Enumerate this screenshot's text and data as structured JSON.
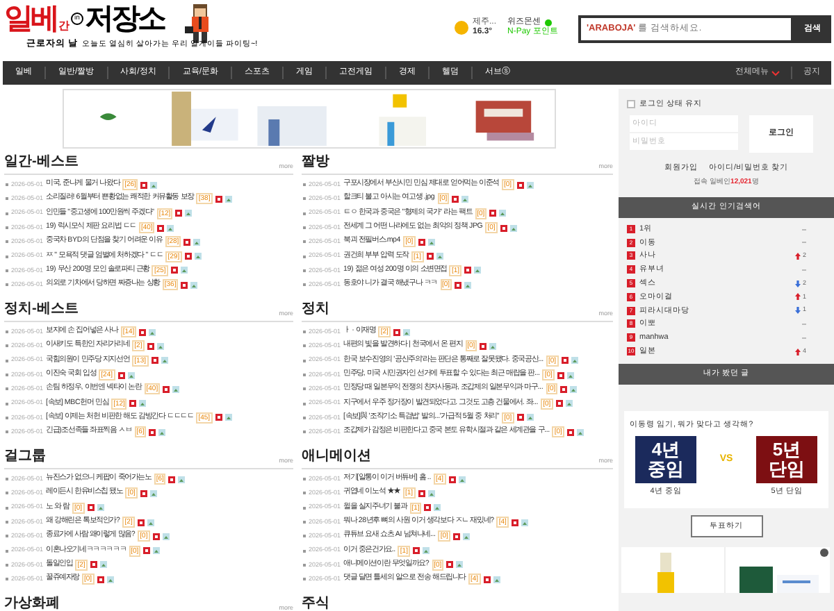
{
  "header": {
    "logo": {
      "main": "일베",
      "small": "간",
      "mark": "in",
      "right": "저장소"
    },
    "tagline_title": "근로자의 날",
    "tagline": "오늘도 열심히 살아가는 우리 일게이들 파이팅~!",
    "weather": {
      "place": "제주...",
      "temp": "16.3°"
    },
    "points": {
      "label": "위즈몬센",
      "value": "N-Pay 포인트"
    },
    "search": {
      "placeholder": "**'ARABOJA'** 를 검색하세요.",
      "button": "검색"
    }
  },
  "nav": {
    "items": [
      "일베",
      "일반/짤방",
      "사회/정치",
      "교육/문화",
      "스포츠",
      "게임",
      "고전게임",
      "경제",
      "헬덤",
      "서브ⓢ"
    ],
    "all_menu": "전체메뉴",
    "notice": "공지"
  },
  "sections": [
    {
      "title": "일간-베스트",
      "more": "more",
      "rows": [
        {
          "date": "2026-05-01",
          "title": "미국, 준나게 물거 나왔다",
          "count": "[26]"
        },
        {
          "date": "2026-05-01",
          "title": "소리질러! 6월부터 쁜황없는 쾌적한 커뮤활동 보장",
          "count": "[38]"
        },
        {
          "date": "2026-05-01",
          "title": "인민들 \"중고생에 100만원씩 주겠다\"",
          "count": "[12]"
        },
        {
          "date": "2026-05-01",
          "title": "19) 럭시모식 제판 요리법 ㄷㄷ",
          "count": "[40]"
        },
        {
          "date": "2026-05-01",
          "title": "중국차 BYD의 단점을 찾기 어려운 이유",
          "count": "[28]"
        },
        {
          "date": "2026-05-01",
          "title": "ㅉ \" 모욕적 댓글 엄벌에 처하겠다 \" ㄷㄷ",
          "count": "[29]"
        },
        {
          "date": "2026-05-01",
          "title": "19) 무산 200명 모인 솔로파티 근황",
          "count": "[25]"
        },
        {
          "date": "2026-05-01",
          "title": "의외로 기차에서 당하면 짜증나는 상황",
          "count": "[36]"
        }
      ]
    },
    {
      "title": "짤방",
      "more": "more",
      "rows": [
        {
          "date": "2026-05-01",
          "title": "구포시장에서 부산시민 민심 제대로 얻어먹는 이준석",
          "count": "[0]"
        },
        {
          "date": "2026-05-01",
          "title": "할크티 불고 아시는 여고생 .jpg",
          "count": "[0]"
        },
        {
          "date": "2026-05-01",
          "title": "ㅌㅇ 한국과 중국은 \"형제의 국가\" 라는 팩트",
          "count": "[0]"
        },
        {
          "date": "2026-05-01",
          "title": "전세계 그 어떤 나라에도 없는 최악의 정책 JPG",
          "count": "[0]"
        },
        {
          "date": "2026-05-01",
          "title": "북괴 전필버스.mp4",
          "count": "[0]"
        },
        {
          "date": "2026-05-01",
          "title": "권건희 부부 압력 도작",
          "count": "[1]"
        },
        {
          "date": "2026-05-01",
          "title": "19) 젊은 여성 200명 이의 소변면접",
          "count": "[1]"
        },
        {
          "date": "2026-05-01",
          "title": "동호야 니가 결국 해냈구나 ㅋㅋ",
          "count": "[0]"
        }
      ]
    },
    {
      "title": "정치-베스트",
      "more": "more",
      "rows": [
        {
          "date": "2026-05-01",
          "title": "보지에 손 집어넣은 사나",
          "count": "[14]"
        },
        {
          "date": "2026-05-01",
          "title": "이새키도 특한인 자리가리네",
          "count": "[2]"
        },
        {
          "date": "2026-05-01",
          "title": "국힘의원이 민주당 지지선언",
          "count": "[13]"
        },
        {
          "date": "2026-05-01",
          "title": "이진숙 국회 입성",
          "count": "[24]"
        },
        {
          "date": "2026-05-01",
          "title": "손팀 하정우, 이번엔 넥타이 논란",
          "count": "[40]"
        },
        {
          "date": "2026-05-01",
          "title": "[속보] MBC헌머 민심",
          "count": "[12]"
        },
        {
          "date": "2026-05-01",
          "title": "[속보] 이제는 처헌 비판한 해도 감방간다 ㄷㄷㄷㄷ",
          "count": "[45]"
        },
        {
          "date": "2026-05-01",
          "title": "긴급)조선족들 좌표찍음 ㅅㅂ",
          "count": "[6]"
        }
      ]
    },
    {
      "title": "정치",
      "more": "more",
      "rows": [
        {
          "date": "2026-05-01",
          "title": "ㅏ · 이재명",
          "count": "[2]"
        },
        {
          "date": "2026-05-01",
          "title": "내편의 빛을 발견하다 | 천국에서 온 편지",
          "count": "[0]"
        },
        {
          "date": "2026-05-01",
          "title": "한국 보수진영의 '공산주의'라는 판단은 통째로 잘못됐다. 중국공산...",
          "count": "[0]"
        },
        {
          "date": "2026-05-01",
          "title": "민주당, 미국 시민권자인 선거에 투표할 수 있다는 최근 매랍을 판...",
          "count": "[0]"
        },
        {
          "date": "2026-05-01",
          "title": "민정당 때 일본무익 전쟁의 친자사동과, 조갑제의 일본무익과 마구...",
          "count": "[0]"
        },
        {
          "date": "2026-05-01",
          "title": "지구에서 우주 정거장이 발견되었다고. 그것도 고층 건물에서. 좌...",
          "count": "[0]"
        },
        {
          "date": "2026-05-01",
          "title": "[속보]與 '조작기소 특검법' 발의...'가급적 5월 중 처리\"",
          "count": "[0]"
        },
        {
          "date": "2026-05-01",
          "title": "조갑제가 감정은 비판한다고 중국 본토 유학시절과 같은 세계관을 구...",
          "count": "[0]"
        }
      ]
    },
    {
      "title": "걸그룹",
      "more": "more",
      "rows": [
        {
          "date": "2026-05-01",
          "title": "뉴진스가 없으니 케팝이 죽어가는노",
          "count": "[6]"
        },
        {
          "date": "2026-05-01",
          "title": "레이든시 한유비스칩 됐노",
          "count": "[0]"
        },
        {
          "date": "2026-05-01",
          "title": "노 와 람",
          "count": "[0]"
        },
        {
          "date": "2026-05-01",
          "title": "왜 강해린은 톡보적인가?",
          "count": "[2]"
        },
        {
          "date": "2026-05-01",
          "title": "종료가에 사람 왜이렇게 많음?",
          "count": "[0]"
        },
        {
          "date": "2026-05-01",
          "title": "이혼나오기네ㅋㅋㅋㅋㅋㅋ",
          "count": "[0]"
        },
        {
          "date": "2026-05-01",
          "title": "돌일인입",
          "count": "[2]"
        },
        {
          "date": "2026-05-01",
          "title": "꿀쥬예자랑",
          "count": "[0]"
        }
      ]
    },
    {
      "title": "애니메이션",
      "more": "more",
      "rows": [
        {
          "date": "2026-05-01",
          "title": "저기[알통이 이거 버튜버] 홈 ..",
          "count": "[4]"
        },
        {
          "date": "2026-05-01",
          "title": "귀엽네 이노석 ★★",
          "count": "[1]"
        },
        {
          "date": "2026-05-01",
          "title": "윌을 실지주녀기 불과",
          "count": "[1]"
        },
        {
          "date": "2026-05-01",
          "title": "뭐나 28년후 뼈의 사원 이거 생각보다 ㅈㄴ 재밌네?",
          "count": "[4]"
        },
        {
          "date": "2026-05-01",
          "title": "큐튜브 요새 쇼츠 AI 넘쳐나네...",
          "count": "[0]"
        },
        {
          "date": "2026-05-01",
          "title": "이거 중은건가요..",
          "count": "[1]"
        },
        {
          "date": "2026-05-01",
          "title": "애니메이션이란 무엇일까요?",
          "count": "[0]"
        },
        {
          "date": "2026-05-01",
          "title": "댓글 달면 틀세의 알으로 전송 해드립니다",
          "count": "[4]"
        }
      ]
    },
    {
      "title": "가상화폐",
      "more": "more"
    },
    {
      "title": "주식"
    }
  ],
  "sidebar": {
    "keep_login": {
      "label": "로그인 상태 유지",
      "checked": false
    },
    "id_placeholder": "아이디",
    "pw_placeholder": "비밀번호",
    "login_button": "로그인",
    "signup": "회원가입",
    "find": "아이디/비밀번호 찾기",
    "online_prefix": "접속 일베인",
    "online_count": "12,021",
    "online_suffix": "명",
    "ranking": {
      "title": "실시간 인기검색어",
      "items": [
        {
          "rank": "1",
          "term": "1위",
          "kind": "same"
        },
        {
          "rank": "2",
          "term": "이동",
          "kind": "same"
        },
        {
          "rank": "3",
          "term": "사나",
          "kind": "up",
          "change": "2"
        },
        {
          "rank": "4",
          "term": "유부녀",
          "kind": "same"
        },
        {
          "rank": "5",
          "term": "섹스",
          "kind": "down",
          "change": "2"
        },
        {
          "rank": "6",
          "term": "오마이걸",
          "kind": "up",
          "change": "1"
        },
        {
          "rank": "7",
          "term": "피라시대마당",
          "kind": "down",
          "change": "1"
        },
        {
          "rank": "8",
          "term": "이뽀",
          "kind": "same"
        },
        {
          "rank": "9",
          "term": "manhwa",
          "kind": "same"
        },
        {
          "rank": "10",
          "term": "일본",
          "kind": "up",
          "change": "4"
        }
      ]
    },
    "history_button": "내가 봤던 글",
    "poll": {
      "question": "이동령 임기, 뭐가 맞다고 생각해?",
      "vs": "VS",
      "options": [
        {
          "line1": "4년",
          "line2": "중임",
          "label": "4년 중임",
          "color": "#1b2a5c"
        },
        {
          "line1": "5년",
          "line2": "단임",
          "label": "5년 단임",
          "color": "#7d0f12"
        }
      ],
      "button": "투표하기"
    }
  }
}
